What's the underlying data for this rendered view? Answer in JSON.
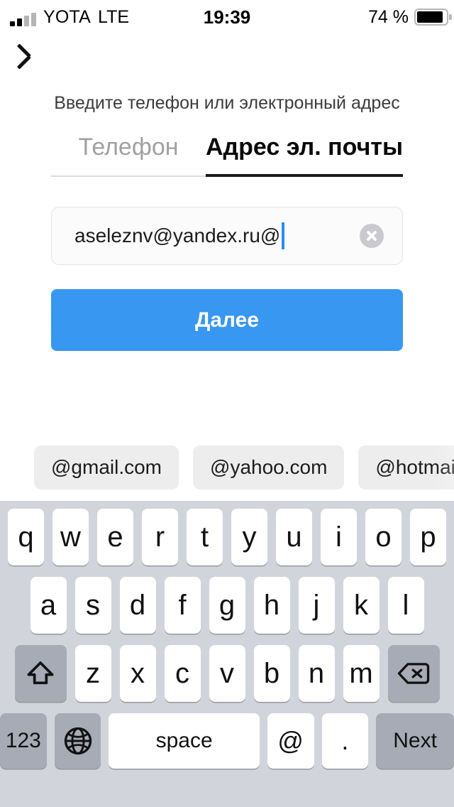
{
  "statusbar": {
    "carrier": "YOTA",
    "network": "LTE",
    "time": "19:39",
    "battery_percent": "74 %",
    "signal_icon": "signal-bars-icon",
    "battery_icon": "battery-icon"
  },
  "nav": {
    "back_icon": "back-chevron-icon"
  },
  "content": {
    "subtitle": "Введите телефон или электронный адрес",
    "tabs": [
      {
        "label": "Телефон",
        "active": false
      },
      {
        "label": "Адрес эл. почты",
        "active": true
      }
    ],
    "input": {
      "value": "aseleznv@yandex.ru@",
      "placeholder": "Адрес эл. почты",
      "clear_icon": "clear-circle-icon"
    },
    "submit_label": "Далее",
    "accent_color": "#3897f0"
  },
  "suggestions": [
    {
      "label": "@gmail.com"
    },
    {
      "label": "@yahoo.com"
    },
    {
      "label": "@hotmail.com"
    }
  ],
  "keyboard": {
    "row1": [
      "q",
      "w",
      "e",
      "r",
      "t",
      "y",
      "u",
      "i",
      "o",
      "p"
    ],
    "row2": [
      "a",
      "s",
      "d",
      "f",
      "g",
      "h",
      "j",
      "k",
      "l"
    ],
    "row3": [
      "z",
      "x",
      "c",
      "v",
      "b",
      "n",
      "m"
    ],
    "shift_icon": "shift-arrow-icon",
    "backspace_icon": "backspace-icon",
    "numbers_label": "123",
    "globe_icon": "globe-icon",
    "space_label": "space",
    "at_label": "@",
    "dot_label": ".",
    "return_label": "Next",
    "background_color": "#d1d4da",
    "key_color": "#ffffff",
    "modifier_key_color": "#a7abb5"
  }
}
